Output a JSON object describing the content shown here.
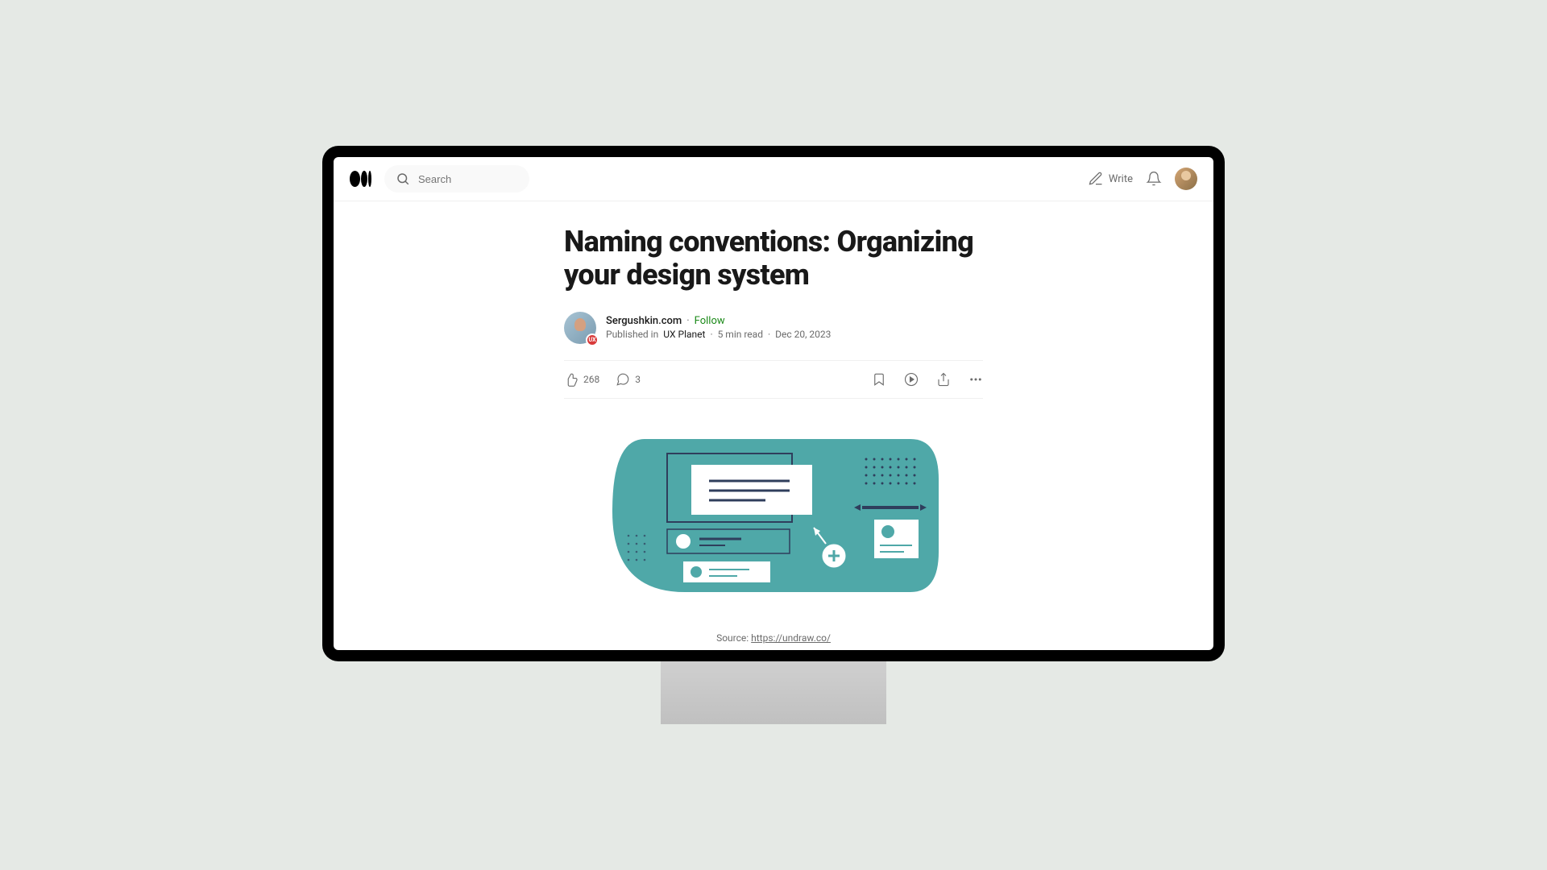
{
  "header": {
    "search_placeholder": "Search",
    "write_label": "Write"
  },
  "article": {
    "title": "Naming conventions: Organizing your design system",
    "author": "Sergushkin.com",
    "follow": "Follow",
    "published_in_prefix": "Published in ",
    "publication": "UX Planet",
    "read_time": "5 min read",
    "date": "Dec 20, 2023",
    "pub_badge": "UX"
  },
  "engagement": {
    "claps": "268",
    "comments": "3"
  },
  "caption": {
    "source_prefix": "Source: ",
    "source_link": "https://undraw.co/"
  },
  "colors": {
    "accent_green": "#1a8917",
    "teal": "#4fa8a8"
  }
}
